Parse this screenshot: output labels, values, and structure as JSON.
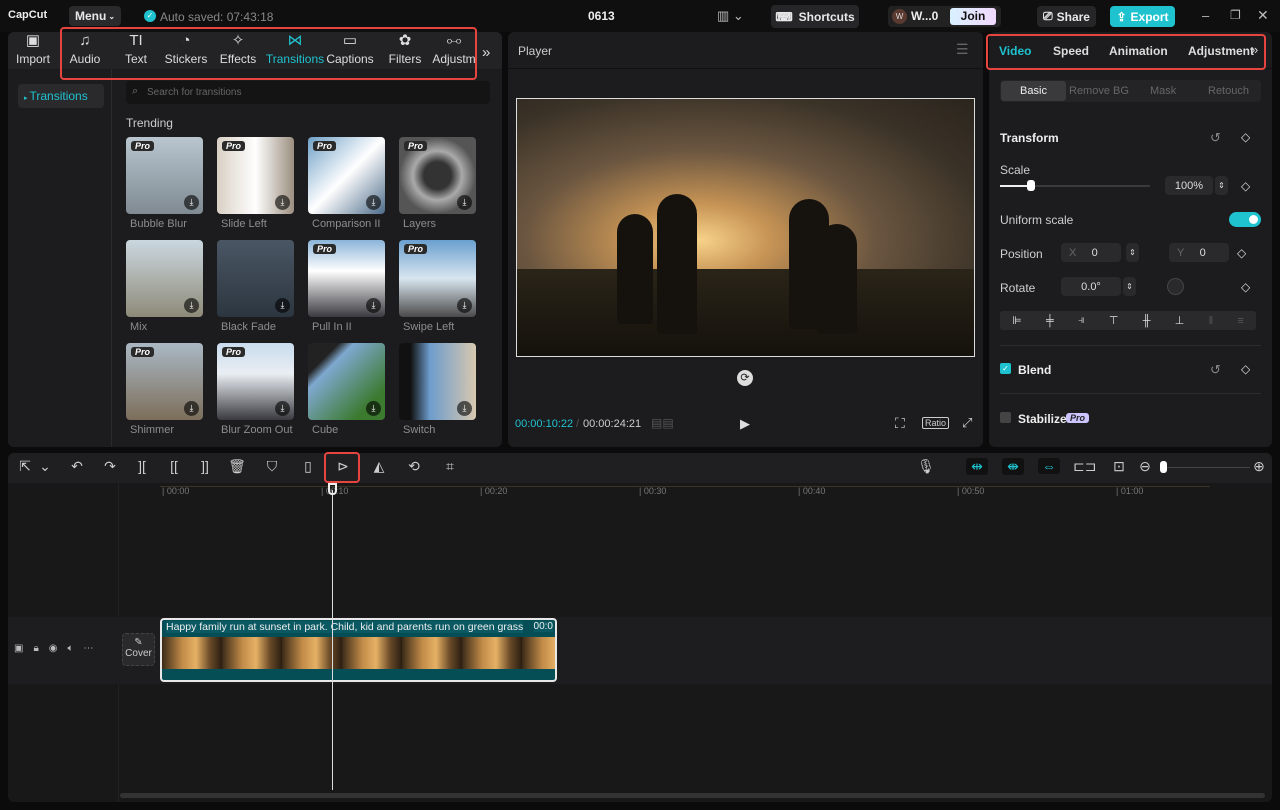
{
  "app": {
    "logo": "CapCut",
    "menu": "Menu",
    "autosave": "Auto saved: 07:43:18",
    "project": "0613",
    "shortcuts": "Shortcuts",
    "user": "W...0",
    "avatar": "W",
    "join_pro": "Join Pro",
    "share": "Share",
    "export": "Export",
    "accent": "#1fc3d0"
  },
  "toolbar": {
    "items": [
      {
        "label": "Import",
        "icon": "import-icon"
      },
      {
        "label": "Audio",
        "icon": "audio-icon"
      },
      {
        "label": "Text",
        "icon": "text-icon"
      },
      {
        "label": "Stickers",
        "icon": "stickers-icon"
      },
      {
        "label": "Effects",
        "icon": "effects-icon"
      },
      {
        "label": "Transitions",
        "icon": "transitions-icon",
        "active": true
      },
      {
        "label": "Captions",
        "icon": "captions-icon"
      },
      {
        "label": "Filters",
        "icon": "filters-icon"
      },
      {
        "label": "Adjustm",
        "icon": "adjustment-icon"
      }
    ]
  },
  "sidebar": {
    "active": "Transitions"
  },
  "search": {
    "placeholder": "Search for transitions"
  },
  "transitions": {
    "section": "Trending",
    "pro_badge": "Pro",
    "items": [
      {
        "label": "Bubble Blur",
        "pro": true
      },
      {
        "label": "Slide Left",
        "pro": true
      },
      {
        "label": "Comparison II",
        "pro": true
      },
      {
        "label": "Layers",
        "pro": true
      },
      {
        "label": "Mix",
        "pro": false
      },
      {
        "label": "Black Fade",
        "pro": false
      },
      {
        "label": "Pull In II",
        "pro": true
      },
      {
        "label": "Swipe Left",
        "pro": true
      },
      {
        "label": "Shimmer",
        "pro": true
      },
      {
        "label": "Blur Zoom Out",
        "pro": true
      },
      {
        "label": "Cube",
        "pro": false
      },
      {
        "label": "Switch",
        "pro": false
      }
    ]
  },
  "player": {
    "title": "Player",
    "current": "00:00:10:22",
    "total": "00:00:24:21",
    "ratio": "Ratio"
  },
  "inspector": {
    "tabs": [
      "Video",
      "Speed",
      "Animation",
      "Adjustment"
    ],
    "active_tab": "Video",
    "subtabs": [
      "Basic",
      "Remove BG",
      "Mask",
      "Retouch"
    ],
    "active_subtab": "Basic",
    "transform": "Transform",
    "scale_label": "Scale",
    "scale_value": "100%",
    "scale_fraction": 0.2,
    "uniform_label": "Uniform scale",
    "uniform_on": true,
    "position_label": "Position",
    "x_label": "X",
    "x_value": "0",
    "y_label": "Y",
    "y_value": "0",
    "rotate_label": "Rotate",
    "rotate_value": "0.0°",
    "blend": "Blend",
    "blend_checked": true,
    "stabilize": "Stabilize",
    "stabilize_checked": false,
    "pro": "Pro"
  },
  "timeline": {
    "ticks": [
      "00:00",
      "00:10",
      "00:20",
      "00:30",
      "00:40",
      "00:50",
      "01:00"
    ],
    "clip_title": "Happy family run at sunset in park. Child, kid and parents run on green grass",
    "clip_duration": "00:0",
    "cover": "Cover"
  }
}
